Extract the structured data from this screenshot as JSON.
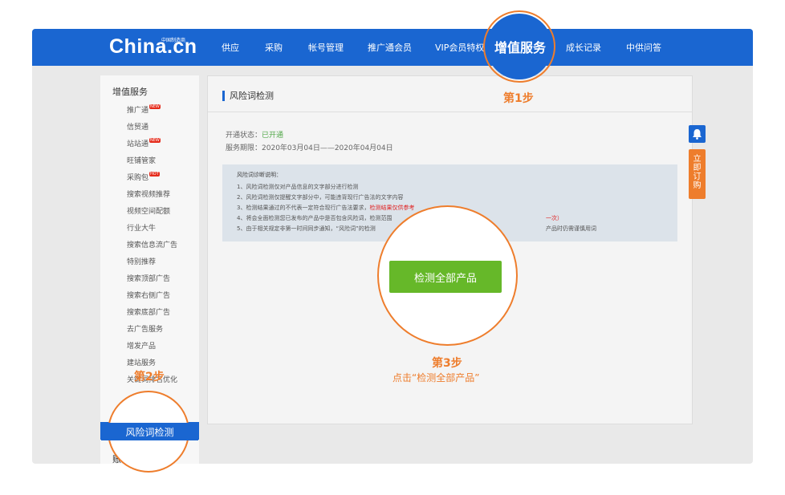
{
  "header": {
    "logo": "China.cn",
    "logo_sub": "中国制造商",
    "nav": [
      "供应",
      "采购",
      "帐号管理",
      "推广通会员",
      "VIP会员特权",
      "增值服务",
      "成长记录",
      "中供问答"
    ]
  },
  "sidebar": {
    "title": "增值服务",
    "items": [
      {
        "label": "推广通",
        "badge": "NEW"
      },
      {
        "label": "信贸通",
        "badge": ""
      },
      {
        "label": "站站通",
        "badge": "NEW"
      },
      {
        "label": "旺铺管家",
        "badge": ""
      },
      {
        "label": "采购包",
        "badge": "HOT"
      },
      {
        "label": "搜索视频推荐",
        "badge": ""
      },
      {
        "label": "视频空间配额",
        "badge": ""
      },
      {
        "label": "行业大牛",
        "badge": ""
      },
      {
        "label": "搜索信息流广告",
        "badge": ""
      },
      {
        "label": "特别推荐",
        "badge": ""
      },
      {
        "label": "搜索顶部广告",
        "badge": ""
      },
      {
        "label": "搜索右侧广告",
        "badge": ""
      },
      {
        "label": "搜索底部广告",
        "badge": ""
      },
      {
        "label": "去广告服务",
        "badge": ""
      },
      {
        "label": "增发产品",
        "badge": ""
      },
      {
        "label": "建站服务",
        "badge": ""
      },
      {
        "label": "关键词排名优化",
        "badge": ""
      }
    ],
    "active": "风险词检测",
    "tail": "账"
  },
  "main": {
    "title": "风险词检测",
    "status_label": "开通状态：",
    "status_value": "已开通",
    "period_label": "服务期限：",
    "period_value": "2020年03月04日——2020年04月04日",
    "notice_title": "风险词诊断说明：",
    "notice_lines": [
      {
        "pre": "1、风险词检测仅对产品信息的文字部分进行检测",
        "red": "",
        "post": ""
      },
      {
        "pre": "2、风险词检测仅提醒文字部分中，可能违背现行广告法的文字内容",
        "red": "",
        "post": ""
      },
      {
        "pre": "3、检测结果通过的不代表一定符合现行广告法要求，",
        "red": "检测结果仅供参考",
        "post": ""
      },
      {
        "pre": "4、将会全面检测您已发布的产品中是否包含风险词，检测范围",
        "red": "",
        "post": "一次）"
      },
      {
        "pre": "5、由于相关规定非第一时间同步通知，“风险词”的检测",
        "red": "",
        "post": "产品时仍需谨慎用词"
      }
    ],
    "check_button": "检测全部产品"
  },
  "floating": {
    "order_label": "立即订购"
  },
  "annotations": {
    "step1": "第1步",
    "step2": "第2步",
    "step3": "第3步",
    "step3_note": "点击“检测全部产品”"
  },
  "colors": {
    "brand_blue": "#1a66d1",
    "accent_orange": "#ee7d2c",
    "button_green": "#66b829"
  }
}
